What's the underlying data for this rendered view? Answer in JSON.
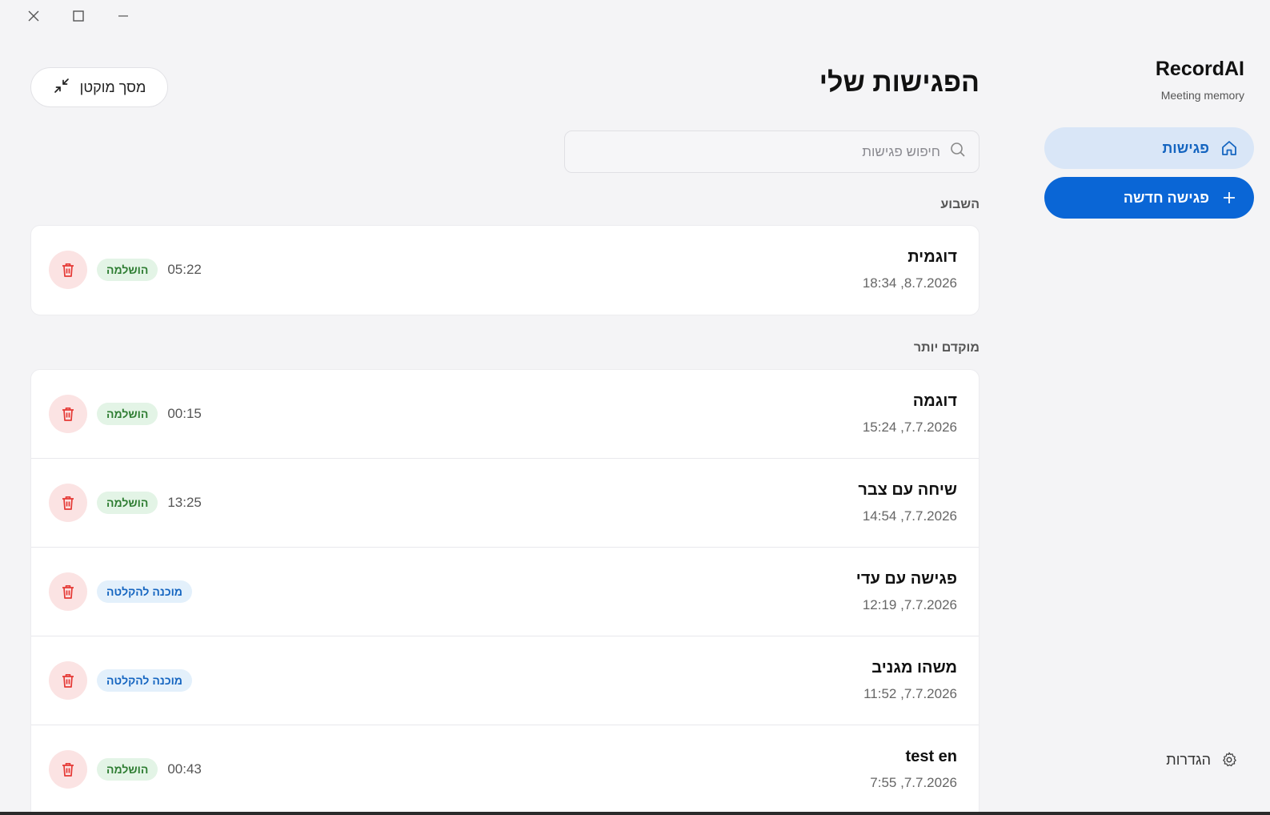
{
  "window": {
    "controls": [
      "close",
      "maximize",
      "minimize"
    ]
  },
  "sidebar": {
    "brand_name": "RecordAI",
    "brand_sub": "Meeting memory",
    "nav": [
      {
        "label": "פגישות",
        "icon": "home-icon",
        "active": true
      },
      {
        "label": "פגישה חדשה",
        "icon": "plus-icon",
        "primary": true
      }
    ],
    "settings_label": "הגדרות",
    "settings_icon": "gear-icon"
  },
  "main": {
    "title": "הפגישות שלי",
    "compact_button": "מסך מוקטן",
    "search_placeholder": "חיפוש פגישות",
    "sections": [
      {
        "label": "השבוע",
        "meetings": [
          {
            "title": "דוגמית",
            "date": "8.7.2026, 18:34",
            "duration": "05:22",
            "status": "הושלמה",
            "status_type": "done"
          }
        ]
      },
      {
        "label": "מוקדם יותר",
        "meetings": [
          {
            "title": "דוגמה",
            "date": "7.7.2026, 15:24",
            "duration": "00:15",
            "status": "הושלמה",
            "status_type": "done"
          },
          {
            "title": "שיחה עם צבר",
            "date": "7.7.2026, 14:54",
            "duration": "13:25",
            "status": "הושלמה",
            "status_type": "done"
          },
          {
            "title": "פגישה עם עדי",
            "date": "7.7.2026, 12:19",
            "duration": "",
            "status": "מוכנה להקלטה",
            "status_type": "ready"
          },
          {
            "title": "משהו מגניב",
            "date": "7.7.2026, 11:52",
            "duration": "",
            "status": "מוכנה להקלטה",
            "status_type": "ready"
          },
          {
            "title": "test en",
            "date": "7.7.2026, 7:55",
            "duration": "00:43",
            "status": "הושלמה",
            "status_type": "done"
          }
        ]
      }
    ]
  },
  "colors": {
    "accent": "#0a66d6",
    "active_nav_bg": "#d9e6f7",
    "delete_bg": "#fbe3e3",
    "delete_icon": "#e53935",
    "done_bg": "#e3f4e6",
    "done_text": "#2e7d32",
    "ready_bg": "#e3f0fb",
    "ready_text": "#1565c0"
  }
}
